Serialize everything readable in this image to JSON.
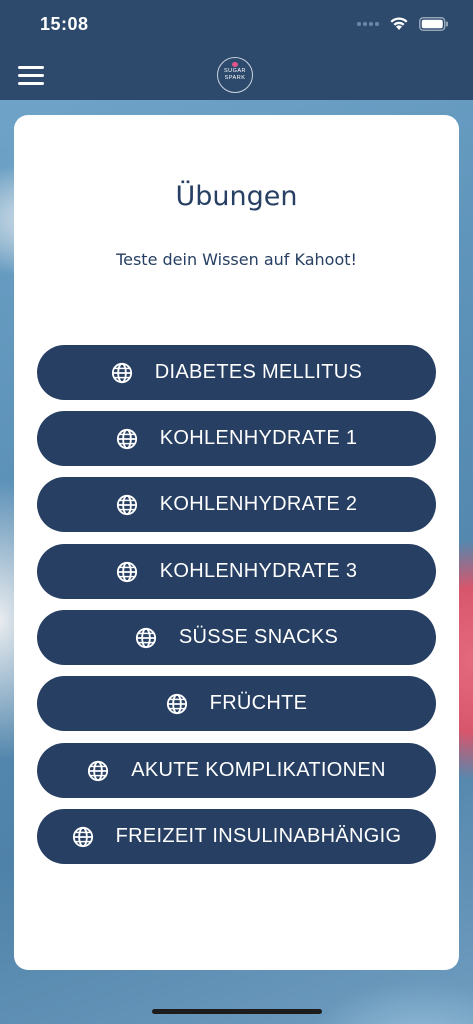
{
  "status_bar": {
    "time": "15:08"
  },
  "header": {
    "logo_line1": "SUGAR",
    "logo_line2": "SPARK"
  },
  "main": {
    "title": "Übungen",
    "subtitle": "Teste dein Wissen auf Kahoot!",
    "buttons": [
      {
        "label": "DIABETES MELLITUS",
        "icon": "globe-icon"
      },
      {
        "label": "KOHLENHYDRATE 1",
        "icon": "globe-icon"
      },
      {
        "label": "KOHLENHYDRATE 2",
        "icon": "globe-icon"
      },
      {
        "label": "KOHLENHYDRATE 3",
        "icon": "globe-icon"
      },
      {
        "label": "SÜSSE SNACKS",
        "icon": "globe-icon"
      },
      {
        "label": "FRÜCHTE",
        "icon": "globe-icon"
      },
      {
        "label": "AKUTE KOMPLIKATIONEN",
        "icon": "globe-icon"
      },
      {
        "label": "FREIZEIT INSULINABHÄNGIG",
        "icon": "globe-icon"
      }
    ]
  },
  "colors": {
    "primary": "#263f63",
    "header": "#2d4a6d",
    "card": "#ffffff",
    "button_text": "#ffffff"
  }
}
